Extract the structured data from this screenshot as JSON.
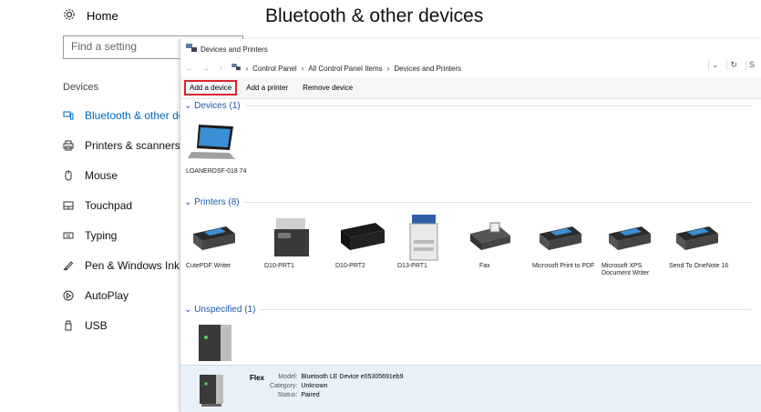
{
  "settings": {
    "home_label": "Home",
    "page_title": "Bluetooth & other devices",
    "search_placeholder": "Find a setting",
    "section_label": "Devices",
    "nav": [
      {
        "label": "Bluetooth & other devi",
        "icon": "bluetooth-devices-icon"
      },
      {
        "label": "Printers & scanners",
        "icon": "printer-icon"
      },
      {
        "label": "Mouse",
        "icon": "mouse-icon"
      },
      {
        "label": "Touchpad",
        "icon": "touchpad-icon"
      },
      {
        "label": "Typing",
        "icon": "keyboard-icon"
      },
      {
        "label": "Pen & Windows Ink",
        "icon": "pen-icon"
      },
      {
        "label": "AutoPlay",
        "icon": "autoplay-icon"
      },
      {
        "label": "USB",
        "icon": "usb-icon"
      }
    ],
    "accent": "#0067b8"
  },
  "window": {
    "title": "Devices and Printers",
    "breadcrumb": [
      "Control Panel",
      "All Control Panel Items",
      "Devices and Printers"
    ],
    "commands": [
      "Add a device",
      "Add a printer",
      "Remove device"
    ],
    "highlight_color": "#d9262a",
    "groups": {
      "devices": {
        "label": "Devices (1)",
        "items": [
          {
            "label": "LOANERDSF-018 74",
            "icon": "laptop-icon"
          }
        ]
      },
      "printers": {
        "label": "Printers (8)",
        "items": [
          {
            "label": "CutePDF Writer",
            "icon": "printer-icon"
          },
          {
            "label": "D10-PRT1",
            "icon": "mfp-printer-icon"
          },
          {
            "label": "D10-PRT2",
            "icon": "inkjet-printer-icon"
          },
          {
            "label": "D13-PRT1",
            "icon": "copier-icon"
          },
          {
            "label": "Fax",
            "icon": "fax-icon"
          },
          {
            "label": "Microsoft Print to PDF",
            "icon": "printer-icon"
          },
          {
            "label": "Microsoft XPS Document Writer",
            "icon": "printer-icon"
          },
          {
            "label": "Send To OneNote 16",
            "icon": "printer-icon"
          }
        ]
      },
      "unspecified": {
        "label": "Unspecified (1)",
        "items": [
          {
            "label": "",
            "icon": "device-box-icon"
          }
        ]
      }
    },
    "details": {
      "name": "Flex",
      "model_key": "Model:",
      "model_val": "Bluetooth LE Device e05305691eb9",
      "category_key": "Category:",
      "category_val": "Unknown",
      "status_key": "Status:",
      "status_val": "Paired"
    }
  }
}
